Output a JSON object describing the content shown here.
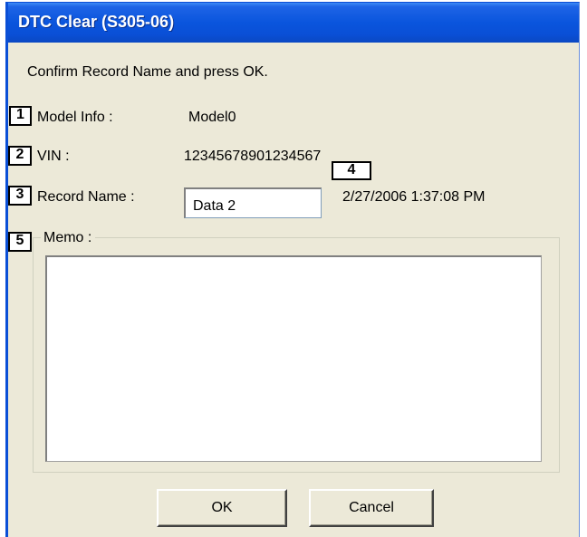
{
  "window": {
    "title": "DTC Clear (S305-06)"
  },
  "dialog": {
    "instruction": "Confirm Record Name and press OK.",
    "model_info_label": "Model Info :",
    "model_info_value": "Model0",
    "vin_label": "VIN :",
    "vin_value": "12345678901234567",
    "record_name_label": "Record Name :",
    "record_name_value": "Data 2",
    "timestamp": "2/27/2006 1:37:08 PM",
    "memo_label": "Memo :",
    "memo_value": ""
  },
  "callouts": [
    "1",
    "2",
    "3",
    "4",
    "5"
  ],
  "buttons": {
    "ok_label": "OK",
    "cancel_label": "Cancel"
  },
  "colors": {
    "titlebar": "#0a4fd6",
    "dialog_bg": "#ece9d8",
    "title_text": "#ffffff"
  }
}
